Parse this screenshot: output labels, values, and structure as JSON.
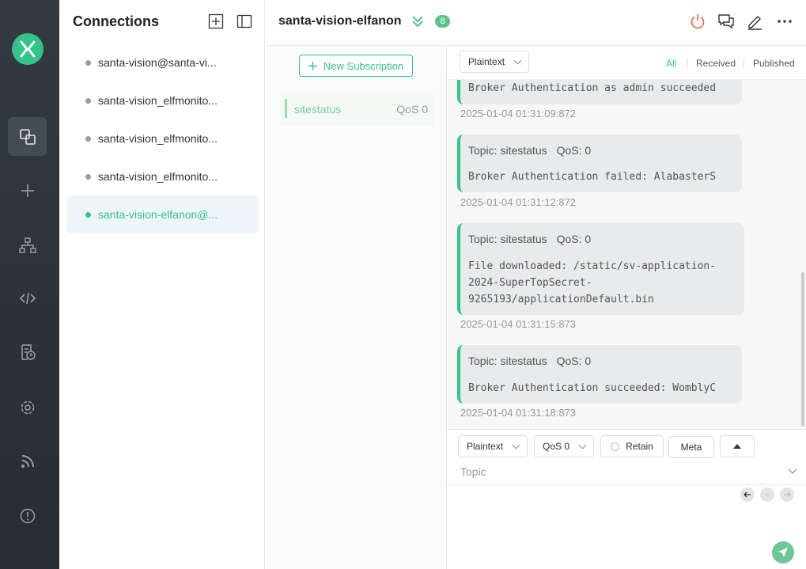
{
  "sidebar": {
    "icons": [
      "logo-icon",
      "connections-icon",
      "new-connection-icon",
      "topology-icon",
      "script-icon",
      "log-icon",
      "settings-icon",
      "subscribe-feed-icon",
      "about-icon"
    ]
  },
  "connections": {
    "title": "Connections",
    "items": [
      {
        "label": "santa-vision@santa-vi...",
        "online": false
      },
      {
        "label": "santa-vision_elfmonito...",
        "online": false
      },
      {
        "label": "santa-vision_elfmonito...",
        "online": false
      },
      {
        "label": "santa-vision_elfmonito...",
        "online": false
      },
      {
        "label": "santa-vision-elfanon@...",
        "online": true
      }
    ]
  },
  "header": {
    "title": "santa-vision-elfanon",
    "badge": "8",
    "colors": {
      "accent": "#34c388",
      "disconnect": "#e8624f"
    }
  },
  "subscriptions": {
    "new_label": "New Subscription",
    "items": [
      {
        "topic": "sitestatus",
        "qos": "QoS 0"
      }
    ]
  },
  "messages": {
    "format": "Plaintext",
    "filters": [
      "All",
      "Received",
      "Published"
    ],
    "list": [
      {
        "body": "Broker Authentication as admin succeeded",
        "time": "2025-01-04 01:31:09:872"
      },
      {
        "topic": "Topic: sitestatus",
        "qos": "QoS: 0",
        "body": "Broker Authentication failed: AlabasterS",
        "time": "2025-01-04 01:31:12:872"
      },
      {
        "topic": "Topic: sitestatus",
        "qos": "QoS: 0",
        "body": "File downloaded: /static/sv-application-\n2024-SuperTopSecret-\n9265193/applicationDefault.bin",
        "time": "2025-01-04 01:31:15:873"
      },
      {
        "topic": "Topic: sitestatus",
        "qos": "QoS: 0",
        "body": "Broker Authentication succeeded: WomblyC",
        "time": "2025-01-04 01:31:18:873"
      }
    ]
  },
  "publish": {
    "format": "Plaintext",
    "qos": "QoS 0",
    "retain_label": "Retain",
    "meta_label": "Meta",
    "topic_placeholder": "Topic"
  }
}
